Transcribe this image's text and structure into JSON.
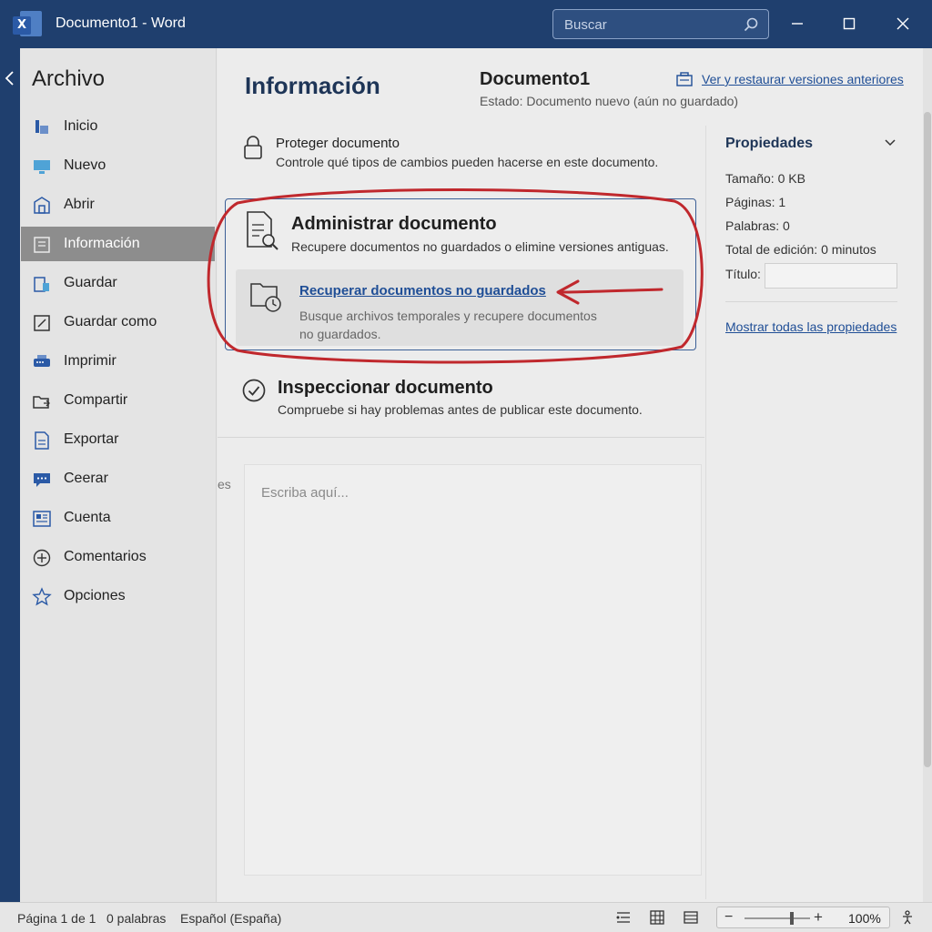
{
  "window": {
    "title": "Documento1 - Word",
    "app_icon_letter": "X",
    "search_placeholder": "Buscar"
  },
  "sidebar": {
    "heading": "Archivo",
    "items": [
      {
        "label": "Inicio",
        "icon": "home-icon"
      },
      {
        "label": "Nuevo",
        "icon": "new-document-icon"
      },
      {
        "label": "Abrir",
        "icon": "open-folder-icon"
      },
      {
        "label": "Información",
        "icon": "info-icon",
        "active": true
      },
      {
        "label": "Guardar",
        "icon": "save-icon"
      },
      {
        "label": "Guardar como",
        "icon": "save-as-icon"
      },
      {
        "label": "Imprimir",
        "icon": "print-icon"
      },
      {
        "label": "Compartir",
        "icon": "share-icon"
      },
      {
        "label": "Exportar",
        "icon": "export-icon"
      },
      {
        "label": "Ceerar",
        "icon": "close-document-icon"
      },
      {
        "label": "Cuenta",
        "icon": "account-icon"
      },
      {
        "label": "Comentarios",
        "icon": "feedback-icon"
      },
      {
        "label": "Opciones",
        "icon": "options-icon"
      }
    ]
  },
  "main": {
    "heading": "Información",
    "document_name": "Documento1",
    "document_state": "Estado: Documento nuevo (aún no guardado)",
    "versions_link": "Ver y restaurar versiones anteriores",
    "protect": {
      "title": "Proteger documento",
      "description": "Controle qué tipos de cambios pueden hacerse en este documento."
    },
    "manage": {
      "title": "Administrar documento",
      "description": "Recupere documentos no guardados o elimine versiones antiguas.",
      "recover_link": "Recuperar documentos no guardados",
      "recover_description": "Busque archivos temporales y recupere documentos no guardados."
    },
    "inspect": {
      "title": "Inspeccionar documento",
      "description": "Compruebe si hay problemas antes de publicar este documento."
    },
    "stray_text": "es",
    "editor_placeholder": "Escriba aquí..."
  },
  "properties": {
    "heading": "Propiedades",
    "size": "Tamaño: 0 KB",
    "pages": "Páginas: 1",
    "words": "Palabras: 0",
    "edit_time": "Total de edición: 0 minutos",
    "title_label": "Título:",
    "title_value": "",
    "show_all": "Mostrar todas las propiedades"
  },
  "statusbar": {
    "page": "Página 1 de 1",
    "words": "0 palabras",
    "language": "Español (España)",
    "zoom_minus": "−",
    "zoom_plus": "+",
    "zoom_level": "100%"
  },
  "colors": {
    "titlebar": "#1f3f6e",
    "accent_link": "#1f4e96",
    "annotation": "#c0282d"
  }
}
